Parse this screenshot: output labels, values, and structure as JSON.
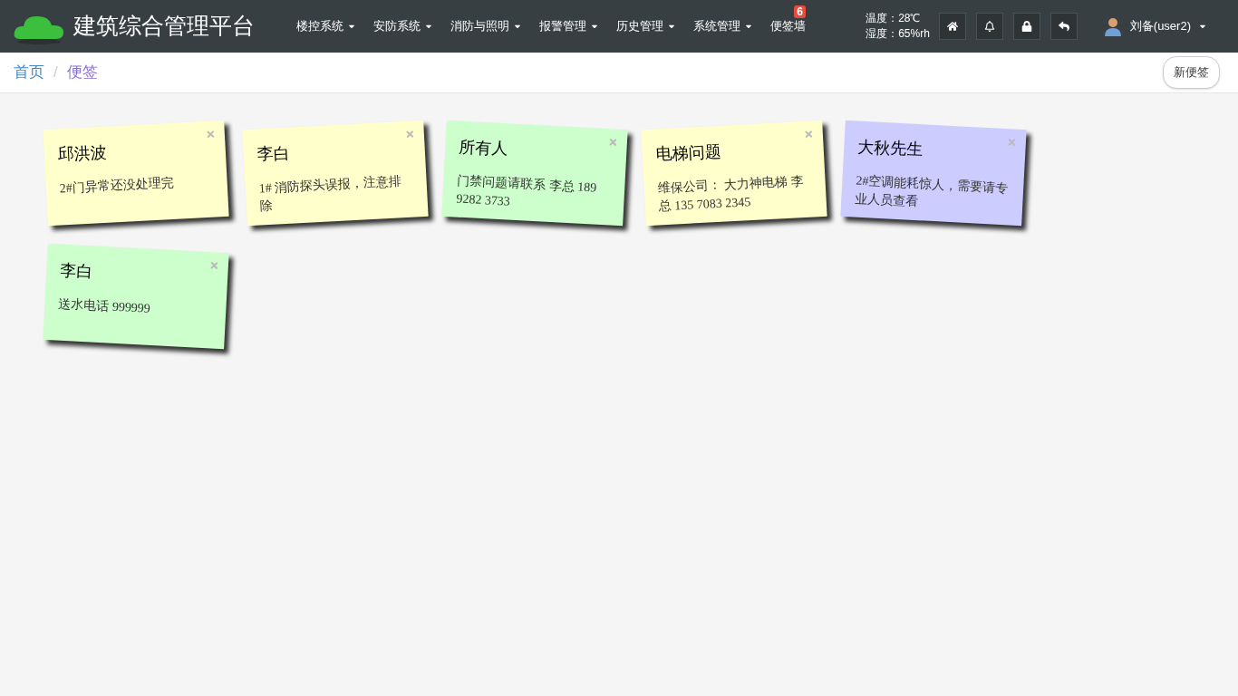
{
  "brand": {
    "title": "建筑综合管理平台"
  },
  "nav": [
    {
      "label": "楼控系统",
      "dropdown": true
    },
    {
      "label": "安防系统",
      "dropdown": true
    },
    {
      "label": "消防与照明",
      "dropdown": true
    },
    {
      "label": "报警管理",
      "dropdown": true
    },
    {
      "label": "历史管理",
      "dropdown": true
    },
    {
      "label": "系统管理",
      "dropdown": true
    },
    {
      "label": "便签墙",
      "dropdown": false,
      "badge": "6"
    }
  ],
  "climate": {
    "temperature": "温度：28℃",
    "humidity": "湿度：65%rh"
  },
  "user": {
    "name": "刘备(user2)"
  },
  "breadcrumb": [
    "首页",
    "便签"
  ],
  "breadcrumb_separator": "/",
  "new_note_button": "新便签",
  "notes": [
    {
      "title": "邱洪波",
      "body": "2#门异常还没处理完",
      "color": "#ffffcc"
    },
    {
      "title": "李白",
      "body": "1# 消防探头误报，注意排除",
      "color": "#ffffcc"
    },
    {
      "title": "所有人",
      "body": "门禁问题请联系 李总 189 9282 3733",
      "color": "#ccffcc"
    },
    {
      "title": "电梯问题",
      "body": "维保公司： 大力神电梯 李总 135 7083 2345",
      "color": "#ffffcc"
    },
    {
      "title": "大秋先生",
      "body": "2#空调能耗惊人，需要请专业人员查看",
      "color": "#ccccff"
    },
    {
      "title": "李白",
      "body": "送水电话 999999",
      "color": "#ccffcc"
    }
  ]
}
